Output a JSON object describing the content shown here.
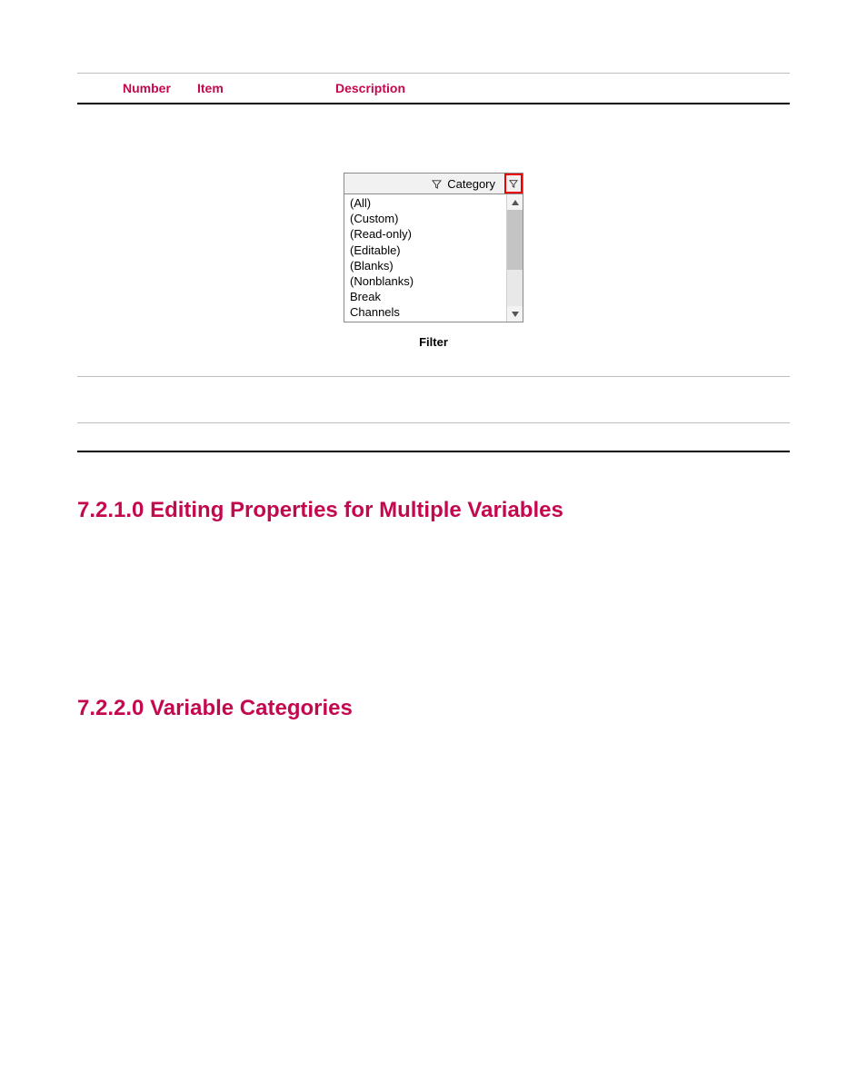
{
  "table": {
    "columns": {
      "number": "Number",
      "item": "Item",
      "description": "Description"
    }
  },
  "figure": {
    "header_label": "Category",
    "items": [
      "(All)",
      "(Custom)",
      "(Read-only)",
      "(Editable)",
      "(Blanks)",
      "(Nonblanks)",
      "Break",
      "Channels"
    ],
    "caption": "Filter"
  },
  "headings": {
    "h1": "7.2.1.0 Editing Properties for Multiple Variables",
    "h2": "7.2.2.0 Variable Categories"
  }
}
